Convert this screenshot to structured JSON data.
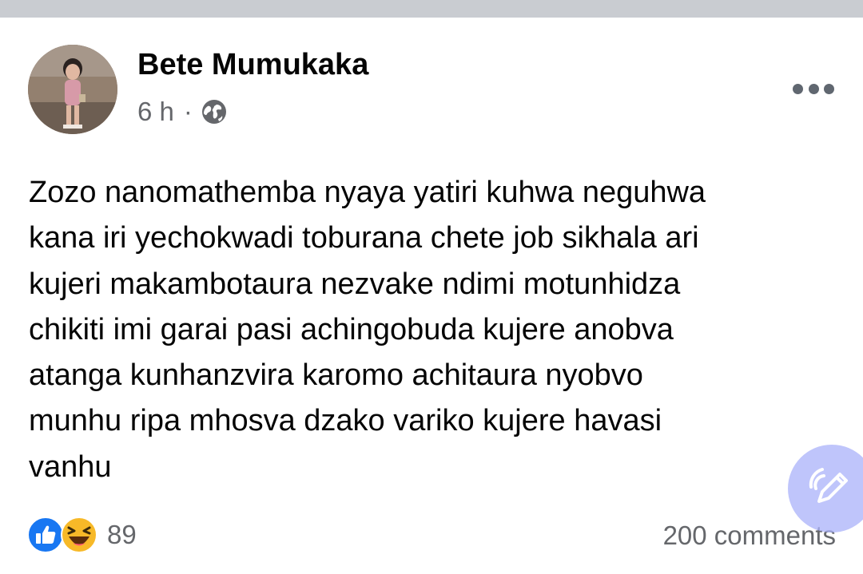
{
  "post": {
    "author": "Bete Mumukaka",
    "time": "6 h",
    "separator": "·",
    "visibility_icon": "globe-icon",
    "text": "Zozo nanomathemba nyaya yatiri kuhwa neguhwa\nkana iri yechokwadi toburana chete job sikhala ari\nkujeri makambotaura nezvake ndimi motunhidza\nchikiti imi garai pasi achingobuda kujere anobva\natanga kunhanzvira karomo achitaura nyobvo\nmunhu ripa mhosva dzako variko kujere havasi\nvanhu"
  },
  "footer": {
    "reaction_icons": [
      "like-icon",
      "haha-icon"
    ],
    "reaction_count": "89",
    "comments_label": "200 comments"
  },
  "colors": {
    "secondary_text": "#65676b",
    "like_blue": "#1877f2",
    "haha_yellow": "#f7b928",
    "fab_bg": "#aab2fa"
  }
}
